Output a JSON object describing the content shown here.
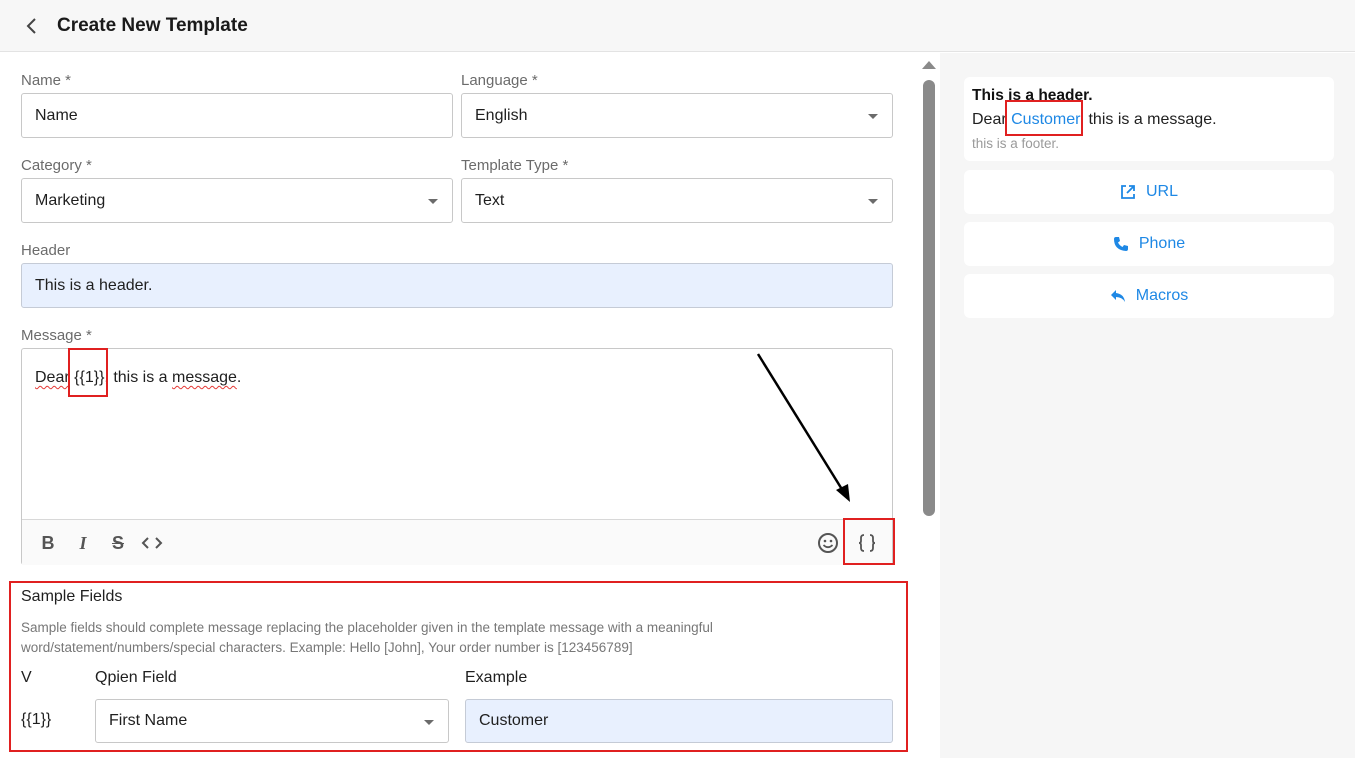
{
  "header": {
    "title": "Create New Template"
  },
  "form": {
    "name": {
      "label": "Name *",
      "value": "Name"
    },
    "language": {
      "label": "Language *",
      "value": "English"
    },
    "category": {
      "label": "Category *",
      "value": "Marketing"
    },
    "template_type": {
      "label": "Template Type *",
      "value": "Text"
    },
    "header_field": {
      "label": "Header",
      "value": "This is a header."
    },
    "message": {
      "label": "Message *",
      "word1": "Dear",
      "placeholder": "{{1}}",
      "rest_prefix": ", this is a ",
      "word_message": "message",
      "rest_suffix": "."
    },
    "toolbar": {
      "bold": "B",
      "italic": "I",
      "strike": "S"
    }
  },
  "sample_fields": {
    "title": "Sample Fields",
    "description": "Sample fields should complete message replacing the placeholder given in the template message with a meaningful word/statement/numbers/special characters. Example: Hello [John], Your order number is [123456789]",
    "columns": {
      "v": "V",
      "field": "Qpien Field",
      "example": "Example"
    },
    "rows": [
      {
        "v": "{{1}}",
        "field": "First Name",
        "example": "Customer"
      }
    ]
  },
  "preview": {
    "header": "This is a header.",
    "msg_prefix": "Dear ",
    "msg_var": "Customer",
    "msg_suffix": ", this is a message.",
    "footer": "this is a footer.",
    "buttons": [
      {
        "label": "URL",
        "icon": "open-in-new-icon"
      },
      {
        "label": "Phone",
        "icon": "phone-icon"
      },
      {
        "label": "Macros",
        "icon": "reply-icon"
      }
    ]
  },
  "colors": {
    "accent": "#1e88e5",
    "highlight": "#e02020",
    "filled": "#e8f0fe"
  }
}
